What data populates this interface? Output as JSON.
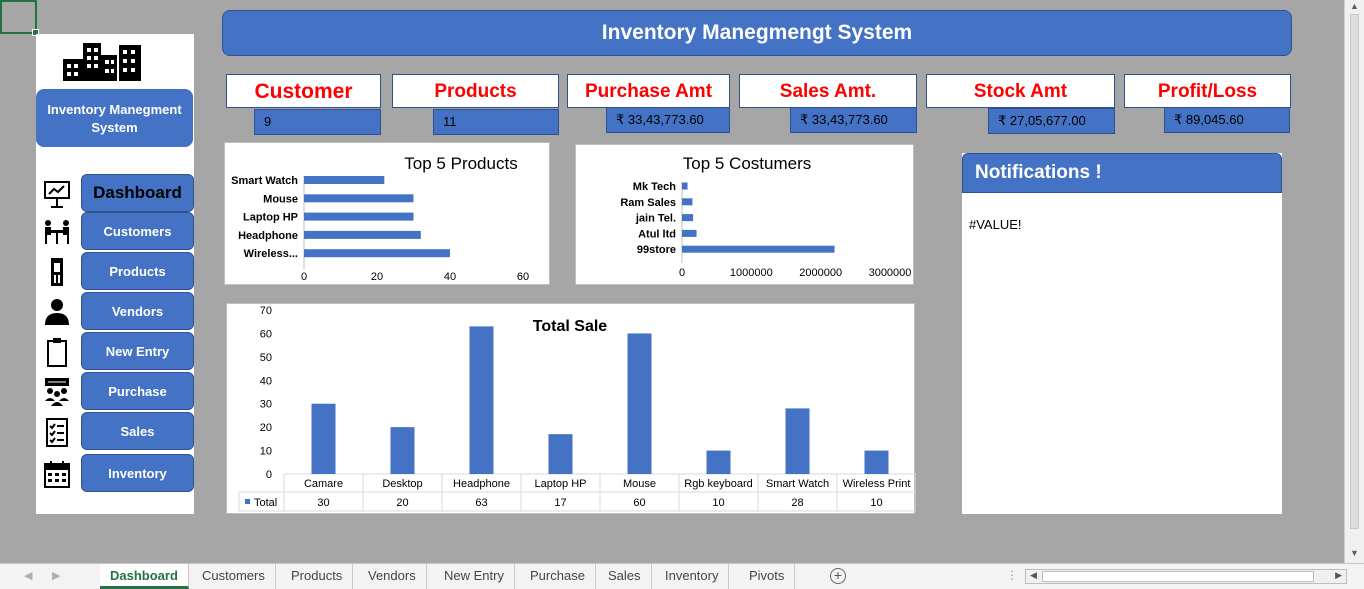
{
  "title": "Inventory Manegmengt System",
  "sidebar": {
    "system_name": "Inventory Manegment System",
    "items": [
      {
        "label": "Dashboard",
        "icon": "presentation-icon"
      },
      {
        "label": "Customers",
        "icon": "meeting-icon"
      },
      {
        "label": "Products",
        "icon": "phone-booth-icon"
      },
      {
        "label": "Vendors",
        "icon": "person-icon"
      },
      {
        "label": "New Entry",
        "icon": "clipboard-icon"
      },
      {
        "label": "Purchase",
        "icon": "team-icon"
      },
      {
        "label": "Sales",
        "icon": "checklist-icon"
      },
      {
        "label": "Inventory",
        "icon": "calendar-icon"
      }
    ]
  },
  "kpis": [
    {
      "label": "Customer",
      "value": "9"
    },
    {
      "label": "Products",
      "value": "11"
    },
    {
      "label": "Purchase Amt",
      "value": "₹ 33,43,773.60"
    },
    {
      "label": "Sales Amt.",
      "value": "₹ 33,43,773.60"
    },
    {
      "label": "Stock Amt",
      "value": "₹ 27,05,677.00"
    },
    {
      "label": "Profit/Loss",
      "value": "₹ 89,045.60"
    }
  ],
  "notifications": {
    "title": "Notifications !",
    "body": "#VALUE!"
  },
  "sheet_tabs": [
    "Dashboard",
    "Customers",
    "Products",
    "Vendors",
    "New Entry",
    "Purchase",
    "Sales",
    "Inventory",
    "Pivots"
  ],
  "active_tab": "Dashboard",
  "colors": {
    "accent": "#4472c4",
    "kpi_label": "#ff0000",
    "excel_green": "#217346"
  },
  "chart_data": [
    {
      "type": "bar",
      "orientation": "horizontal",
      "title": "Top 5 Products",
      "categories": [
        "Smart Watch",
        "Mouse",
        "Laptop HP",
        "Headphone",
        "Wireless..."
      ],
      "values": [
        22,
        30,
        30,
        32,
        40
      ],
      "xlim": [
        0,
        60
      ],
      "xticks": [
        "0",
        "20",
        "40",
        "60"
      ]
    },
    {
      "type": "bar",
      "orientation": "horizontal",
      "title": "Top 5 Costumers",
      "categories": [
        "Mk Tech",
        "Ram Sales",
        "jain Tel.",
        "Atul ltd",
        "99store"
      ],
      "values": [
        80000,
        150000,
        160000,
        210000,
        2200000
      ],
      "xlim": [
        0,
        3000000
      ],
      "xticks": [
        "0",
        "1000000",
        "2000000",
        "3000000"
      ]
    },
    {
      "type": "bar",
      "title": "Total Sale",
      "categories": [
        "Camare",
        "Desktop",
        "Headphone",
        "Laptop HP",
        "Mouse",
        "Rgb keyboard",
        "Smart Watch",
        "Wireless Print"
      ],
      "series": [
        {
          "name": "Total",
          "values": [
            30,
            20,
            63,
            17,
            60,
            10,
            28,
            10
          ]
        }
      ],
      "ylim": [
        0,
        70
      ],
      "yticks": [
        "0",
        "10",
        "20",
        "30",
        "40",
        "50",
        "60",
        "70"
      ],
      "data_table": true
    }
  ]
}
